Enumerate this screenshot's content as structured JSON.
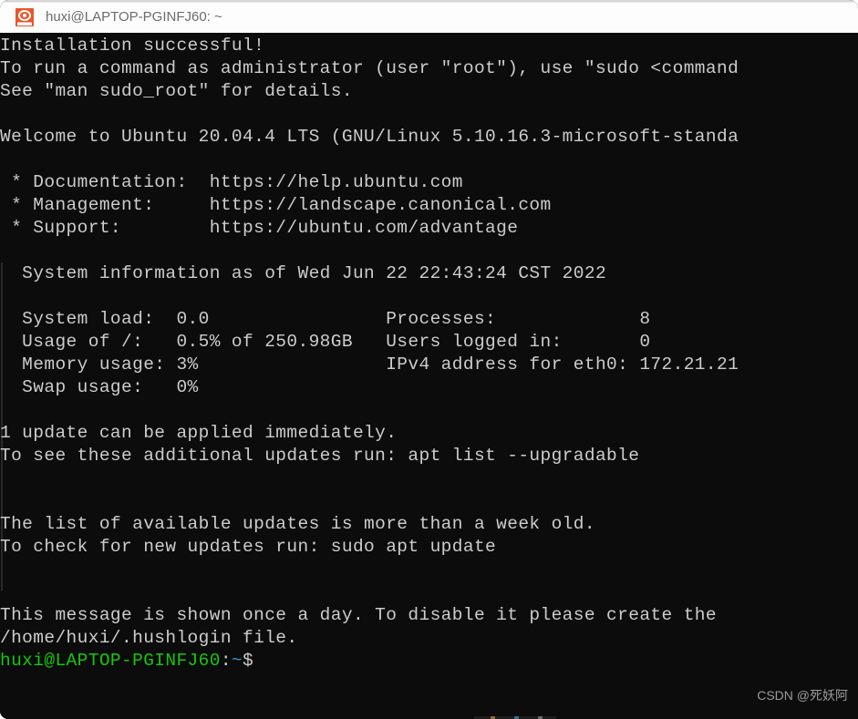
{
  "window": {
    "title": "huxi@LAPTOP-PGINFJ60: ~",
    "icon": "ubuntu-app-icon",
    "background": "#0c0c0c",
    "titlebar_background": "#fdfdfd"
  },
  "terminal": {
    "foreground": "#cccccc",
    "prompt_user_color": "#16c60c",
    "prompt_path_color": "#3a96dd",
    "lines": [
      "Installation successful!",
      "To run a command as administrator (user \"root\"), use \"sudo <command",
      "See \"man sudo_root\" for details.",
      "",
      "Welcome to Ubuntu 20.04.4 LTS (GNU/Linux 5.10.16.3-microsoft-standa",
      "",
      " * Documentation:  https://help.ubuntu.com",
      " * Management:     https://landscape.canonical.com",
      " * Support:        https://ubuntu.com/advantage",
      "",
      "  System information as of Wed Jun 22 22:43:24 CST 2022",
      "",
      "  System load:  0.0                Processes:             8",
      "  Usage of /:   0.5% of 250.98GB   Users logged in:       0",
      "  Memory usage: 3%                 IPv4 address for eth0: 172.21.21",
      "  Swap usage:   0%",
      "",
      "1 update can be applied immediately.",
      "To see these additional updates run: apt list --upgradable",
      "",
      "",
      "The list of available updates is more than a week old.",
      "To check for new updates run: sudo apt update",
      "",
      "",
      "This message is shown once a day. To disable it please create the",
      "/home/huxi/.hushlogin file."
    ],
    "prompt": {
      "user_host": "huxi@LAPTOP-PGINFJ60",
      "separator": ":",
      "path": "~",
      "symbol": "$"
    }
  },
  "system_information": {
    "timestamp": "Wed Jun 22 22:43:24 CST 2022",
    "system_load": "0.0",
    "usage_of_root": "0.5% of 250.98GB",
    "memory_usage": "3%",
    "swap_usage": "0%",
    "processes": "8",
    "users_logged_in": "0",
    "ipv4_address_eth0": "172.21.21"
  },
  "release": {
    "distro": "Ubuntu 20.04.4 LTS",
    "kernel": "GNU/Linux 5.10.16.3-microsoft-standa",
    "documentation_url": "https://help.ubuntu.com",
    "management_url": "https://landscape.canonical.com",
    "support_url": "https://ubuntu.com/advantage"
  },
  "watermark": {
    "text": "CSDN @死妖阿"
  }
}
